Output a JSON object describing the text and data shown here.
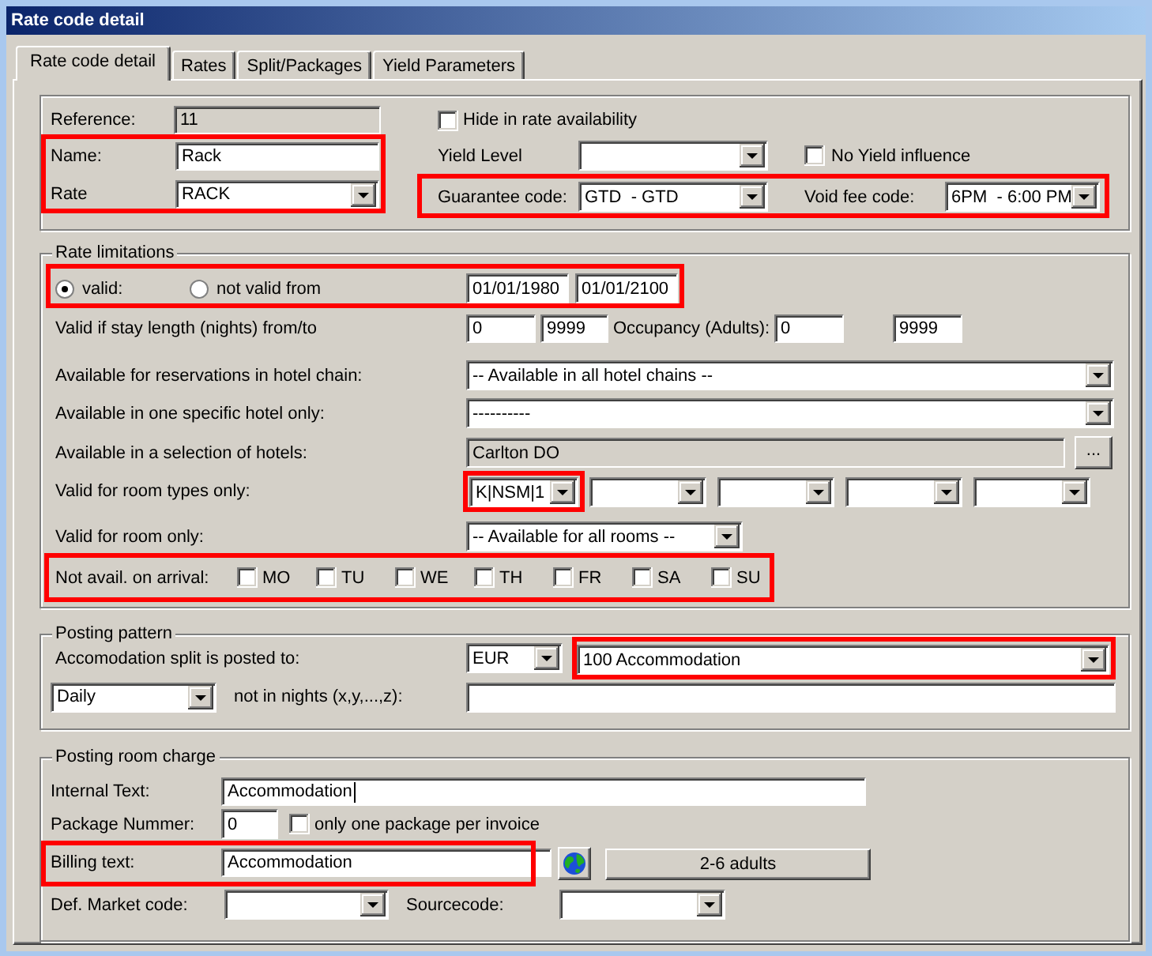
{
  "window": {
    "title": "Rate code detail"
  },
  "tabs": [
    {
      "label": "Rate code detail",
      "selected": true
    },
    {
      "label": "Rates",
      "selected": false
    },
    {
      "label": "Split/Packages",
      "selected": false
    },
    {
      "label": "Yield Parameters",
      "selected": false
    }
  ],
  "general": {
    "reference": {
      "label": "Reference:",
      "value": "11",
      "disabled": true
    },
    "name_rate": {
      "highlighted": true,
      "name": {
        "label": "Name:",
        "value": "Rack"
      },
      "rate": {
        "label": "Rate",
        "value": "RACK"
      }
    },
    "hide_in_rate_availability": {
      "label": "Hide in rate availability",
      "checked": false
    },
    "yield_level": {
      "label": "Yield Level"
    },
    "no_yield_influence": {
      "label": "No Yield influence",
      "checked": false
    },
    "codes": {
      "highlighted": true,
      "guarantee_code": {
        "label": "Guarantee code:",
        "value": "GTD  - GTD"
      },
      "void_fee_code": {
        "label": "Void fee code:",
        "value": "6PM  - 6:00 PM"
      }
    }
  },
  "rate_limitations": {
    "title": "Rate limitations",
    "validity": {
      "highlighted": true,
      "options": [
        {
          "label": "valid:",
          "selected": true
        },
        {
          "label": "not valid from",
          "selected": false
        }
      ],
      "from": "01/01/1980",
      "to": "01/01/2100"
    },
    "stay_length": {
      "label": "Valid if stay length (nights) from/to",
      "from": "0",
      "to": "9999"
    },
    "occupancy": {
      "label": "Occupancy (Adults):",
      "from": "0",
      "to": "9999"
    },
    "hotel_chain": {
      "label": "Available for reservations in hotel chain:",
      "value": "-- Available in all hotel chains --"
    },
    "specific_hotel": {
      "label": "Available in one specific hotel only:",
      "value": "----------"
    },
    "hotel_selection": {
      "label": "Available in a selection of hotels:",
      "value": "Carlton DO",
      "disabled": true,
      "button": "..."
    },
    "room_types": {
      "label": "Valid for room types only:",
      "selects": [
        {
          "value": "K|NSM|1",
          "highlighted": true
        },
        {
          "highlighted": false
        },
        {
          "highlighted": false
        },
        {
          "highlighted": false
        },
        {
          "highlighted": false
        }
      ]
    },
    "room_only": {
      "label": "Valid for room only:",
      "value": "-- Available for all rooms --"
    },
    "arrival_days": {
      "highlighted": true,
      "label": "Not avail. on arrival:",
      "days": [
        {
          "label": "MO",
          "checked": false
        },
        {
          "label": "TU",
          "checked": false
        },
        {
          "label": "WE",
          "checked": false
        },
        {
          "label": "TH",
          "checked": false
        },
        {
          "label": "FR",
          "checked": false
        },
        {
          "label": "SA",
          "checked": false
        },
        {
          "label": "SU",
          "checked": false
        }
      ]
    }
  },
  "posting_pattern": {
    "title": "Posting pattern",
    "split": {
      "label": "Accomodation split is posted to:",
      "currency": "EUR",
      "account": {
        "value": "100 Accommodation",
        "highlighted": true
      }
    },
    "frequency": "Daily",
    "nights": {
      "label": "not in nights (x,y,...,z):"
    }
  },
  "posting_room_charge": {
    "title": "Posting room charge",
    "internal_text": {
      "label": "Internal Text:",
      "value": "Accommodation",
      "focused": true
    },
    "package_number": {
      "label": "Package Nummer:",
      "value": "0"
    },
    "one_package_per_invoice": {
      "label": "only one package per invoice",
      "checked": false
    },
    "billing_text": {
      "label": "Billing text:",
      "value": "Accommodation",
      "highlighted": true
    },
    "adults_button": "2-6 adults",
    "market_code": {
      "label": "Def. Market code:"
    },
    "source_code": {
      "label": "Sourcecode:"
    }
  }
}
